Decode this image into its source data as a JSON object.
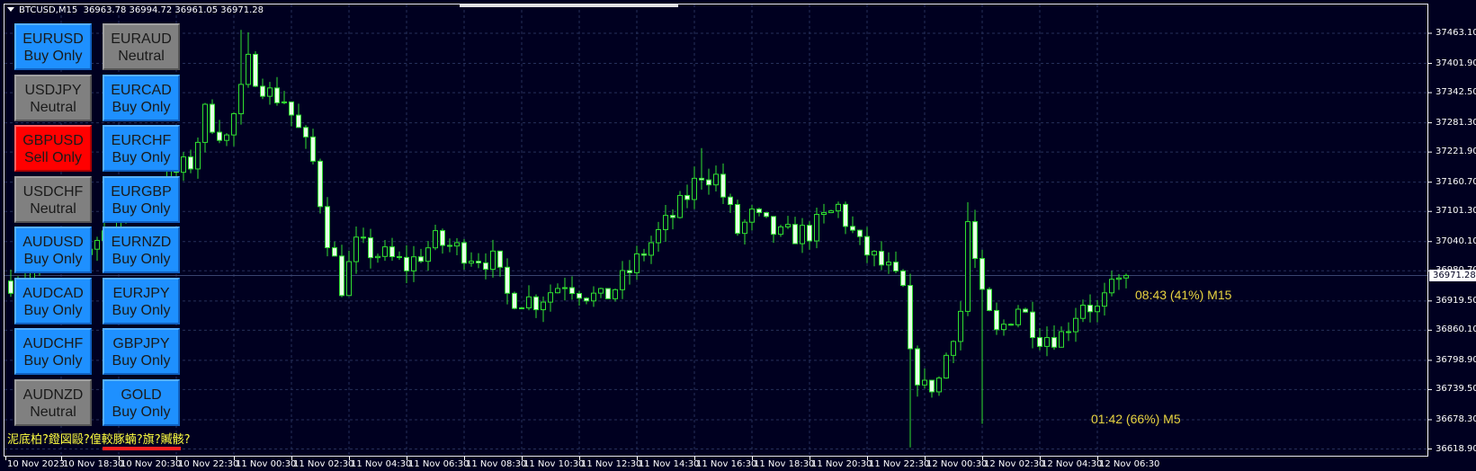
{
  "header": {
    "symbol": "BTCUSD,M15",
    "ohlc": "36963.78 36994.72 36961.05 36971.28"
  },
  "colors": {
    "background": "#000020",
    "grid": "#26305a",
    "candle": "#30e030",
    "bear_body": "#e6ffe6",
    "buy": "#1e90ff",
    "neutral": "#808080",
    "sell": "#ff0000",
    "timer": "#e8d440"
  },
  "buttons": [
    {
      "pair": "EURUSD",
      "status": "Buy Only",
      "type": "buy"
    },
    {
      "pair": "EURAUD",
      "status": "Neutral",
      "type": "neutral"
    },
    {
      "pair": "USDJPY",
      "status": "Neutral",
      "type": "neutral"
    },
    {
      "pair": "EURCAD",
      "status": "Buy Only",
      "type": "buy"
    },
    {
      "pair": "GBPUSD",
      "status": "Sell Only",
      "type": "sell"
    },
    {
      "pair": "EURCHF",
      "status": "Buy Only",
      "type": "buy"
    },
    {
      "pair": "USDCHF",
      "status": "Neutral",
      "type": "neutral"
    },
    {
      "pair": "EURGBP",
      "status": "Buy Only",
      "type": "buy"
    },
    {
      "pair": "AUDUSD",
      "status": "Buy Only",
      "type": "buy"
    },
    {
      "pair": "EURNZD",
      "status": "Buy Only",
      "type": "buy"
    },
    {
      "pair": "AUDCAD",
      "status": "Buy Only",
      "type": "buy"
    },
    {
      "pair": "EURJPY",
      "status": "Buy Only",
      "type": "buy"
    },
    {
      "pair": "AUDCHF",
      "status": "Buy Only",
      "type": "buy"
    },
    {
      "pair": "GBPJPY",
      "status": "Buy Only",
      "type": "buy"
    },
    {
      "pair": "AUDNZD",
      "status": "Neutral",
      "type": "neutral"
    },
    {
      "pair": "GOLD",
      "status": "Buy Only",
      "type": "buy"
    }
  ],
  "garbled_text": "泥底柏?鐙図毆?偟較豚蝻?旗?贓骸?",
  "price_axis": [
    "37463.10",
    "37401.90",
    "37342.50",
    "37281.30",
    "37221.90",
    "37160.70",
    "37101.30",
    "37040.10",
    "36980.70",
    "36919.50",
    "36860.10",
    "36798.90",
    "36739.50",
    "36678.30",
    "36618.90"
  ],
  "current_price": "36971.28",
  "time_axis": [
    "10 Nov 2023",
    "10 Nov 18:30",
    "10 Nov 20:30",
    "10 Nov 22:30",
    "11 Nov 00:30",
    "11 Nov 02:30",
    "11 Nov 04:30",
    "11 Nov 06:30",
    "11 Nov 08:30",
    "11 Nov 10:30",
    "11 Nov 12:30",
    "11 Nov 14:30",
    "11 Nov 16:30",
    "11 Nov 18:30",
    "11 Nov 20:30",
    "11 Nov 22:30",
    "12 Nov 00:30",
    "12 Nov 02:30",
    "12 Nov 04:30",
    "12 Nov 06:30"
  ],
  "timers": {
    "m15": "08:43 (41%) M15",
    "m5": "01:42 (66%) M5"
  },
  "chart_data": {
    "type": "candlestick",
    "symbol": "BTCUSD",
    "timeframe": "M15",
    "ylim": [
      36618.9,
      37463.1
    ],
    "price_keypoints": [
      [
        0,
        36960
      ],
      [
        10,
        37020
      ],
      [
        20,
        37150
      ],
      [
        25,
        37200
      ],
      [
        27,
        37300
      ],
      [
        30,
        37250
      ],
      [
        32,
        37340
      ],
      [
        33,
        37400
      ],
      [
        36,
        37340
      ],
      [
        38,
        37330
      ],
      [
        42,
        37200
      ],
      [
        44,
        37050
      ],
      [
        46,
        36950
      ],
      [
        48,
        37030
      ],
      [
        52,
        37010
      ],
      [
        55,
        36990
      ],
      [
        59,
        37040
      ],
      [
        63,
        37020
      ],
      [
        67,
        37000
      ],
      [
        69,
        36930
      ],
      [
        73,
        36920
      ],
      [
        77,
        36960
      ],
      [
        82,
        36920
      ],
      [
        85,
        36960
      ],
      [
        88,
        37020
      ],
      [
        93,
        37110
      ],
      [
        96,
        37180
      ],
      [
        98,
        37170
      ],
      [
        101,
        37060
      ],
      [
        103,
        37090
      ],
      [
        107,
        37050
      ],
      [
        111,
        37060
      ],
      [
        115,
        37110
      ],
      [
        118,
        37030
      ],
      [
        122,
        36980
      ],
      [
        124,
        36940
      ],
      [
        125,
        36800
      ],
      [
        127,
        36740
      ],
      [
        129,
        36760
      ],
      [
        131,
        36860
      ],
      [
        132,
        36900
      ],
      [
        133,
        37080
      ],
      [
        135,
        36920
      ],
      [
        137,
        36850
      ],
      [
        140,
        36910
      ],
      [
        143,
        36850
      ],
      [
        146,
        36850
      ],
      [
        149,
        36920
      ],
      [
        151,
        36900
      ],
      [
        153,
        36940
      ],
      [
        155,
        36971
      ]
    ],
    "extreme_wicks": [
      [
        32,
        37470
      ],
      [
        33,
        37465
      ],
      [
        125,
        36622
      ],
      [
        133,
        37120
      ],
      [
        135,
        36670
      ],
      [
        96,
        37230
      ]
    ]
  }
}
